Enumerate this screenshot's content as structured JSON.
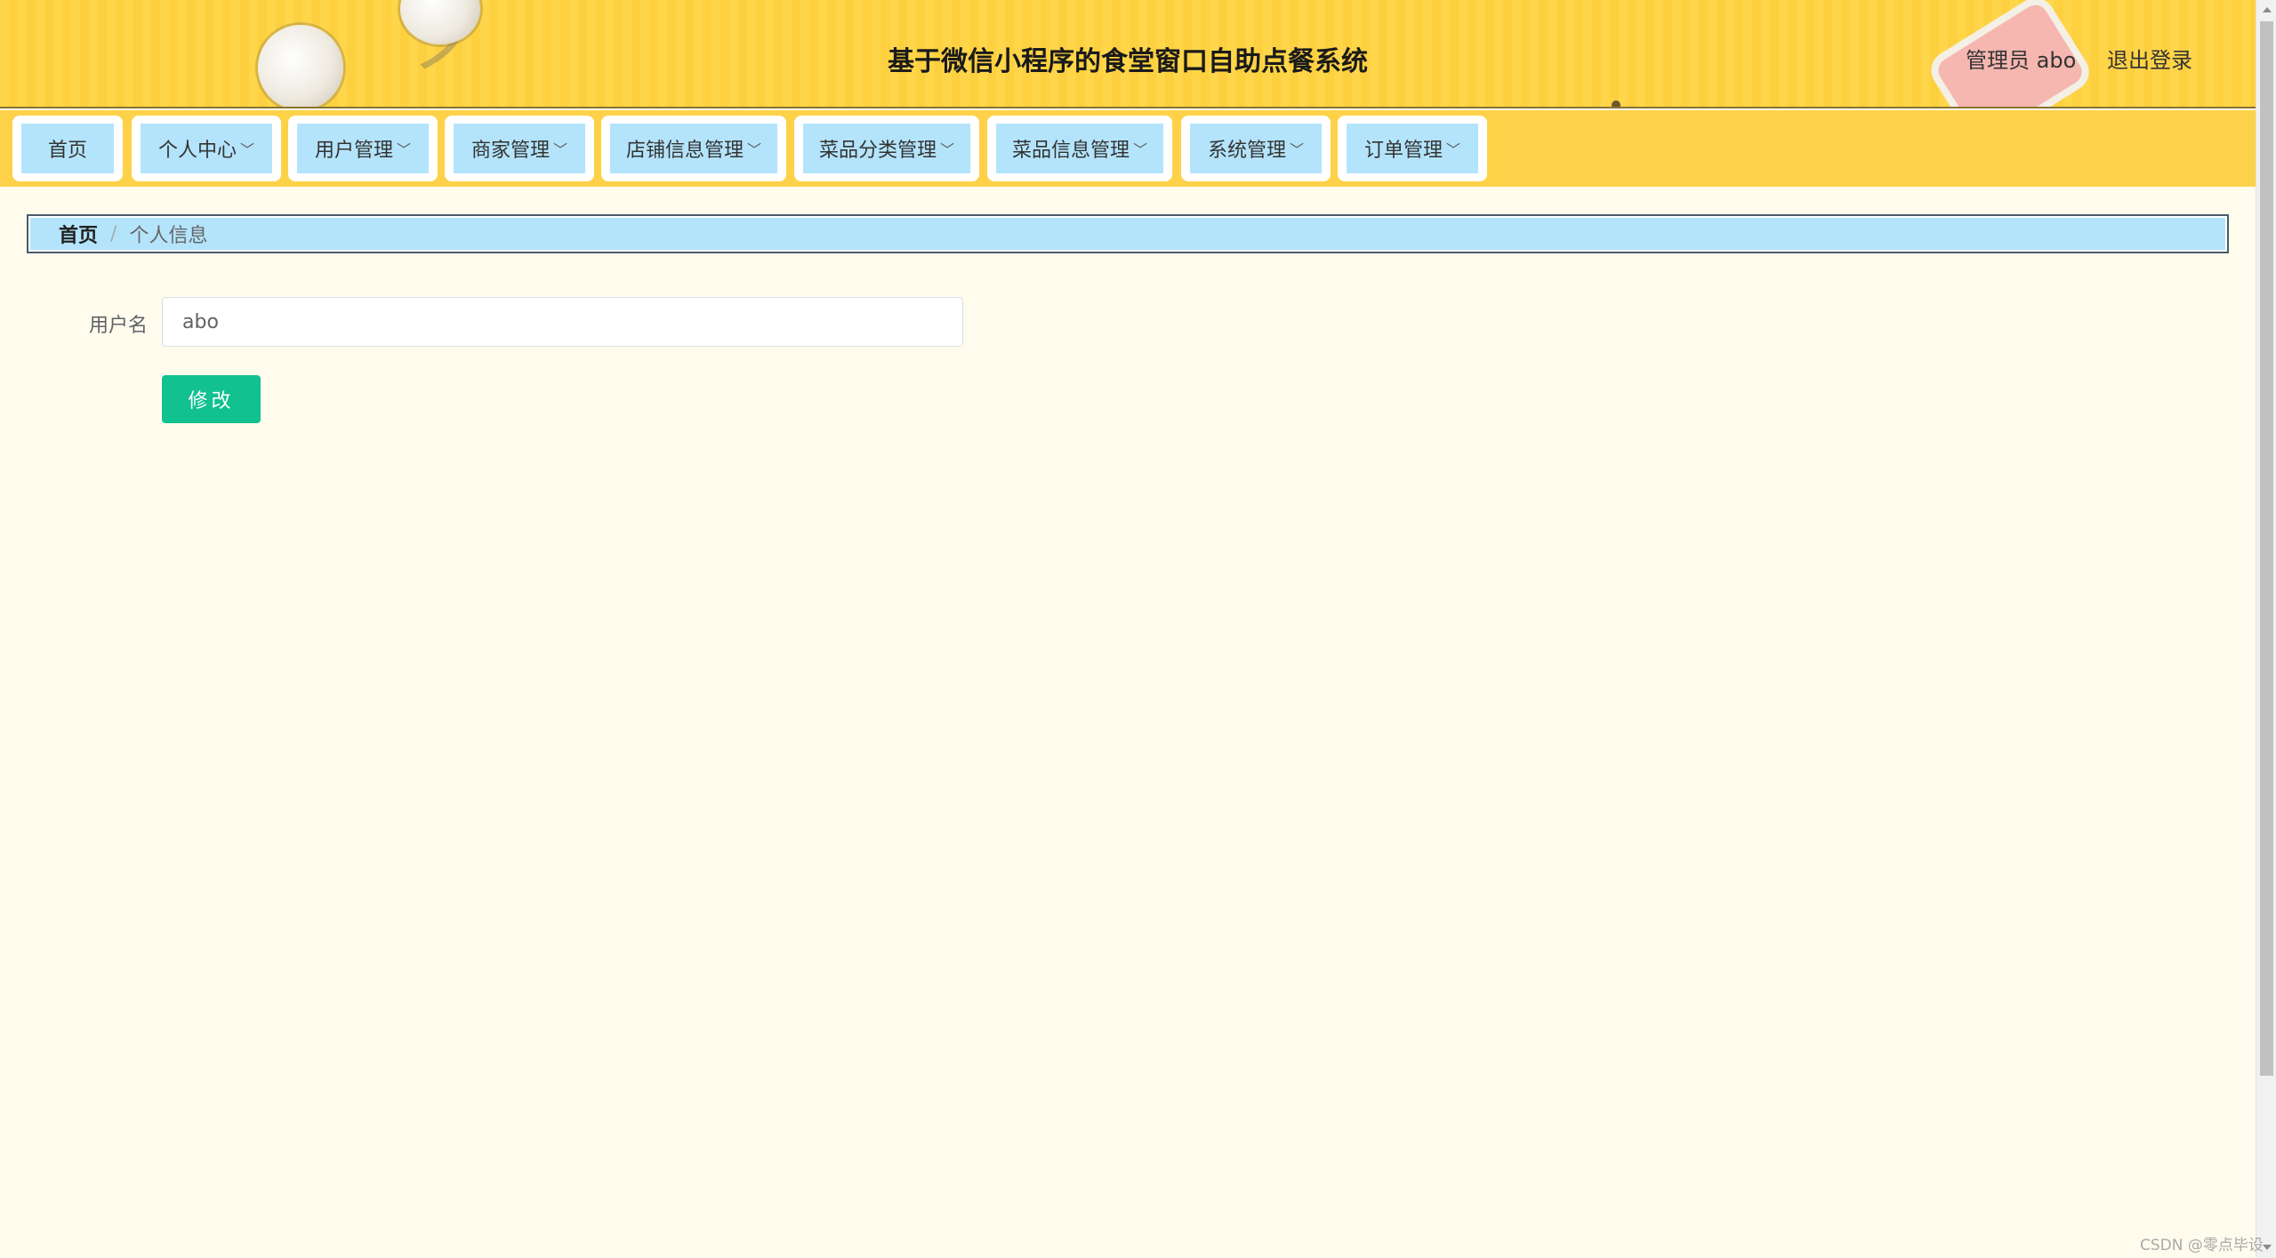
{
  "header": {
    "title": "基于微信小程序的食堂窗口自助点餐系统",
    "user_role": "管理员 abo",
    "logout_label": "退出登录"
  },
  "nav": {
    "items": [
      {
        "label": "首页",
        "has_dropdown": false
      },
      {
        "label": "个人中心",
        "has_dropdown": true
      },
      {
        "label": "用户管理",
        "has_dropdown": true
      },
      {
        "label": "商家管理",
        "has_dropdown": true
      },
      {
        "label": "店铺信息管理",
        "has_dropdown": true
      },
      {
        "label": "菜品分类管理",
        "has_dropdown": true
      },
      {
        "label": "菜品信息管理",
        "has_dropdown": true
      },
      {
        "label": "系统管理",
        "has_dropdown": true
      },
      {
        "label": "订单管理",
        "has_dropdown": true
      }
    ],
    "dropdown_icon": "chevron-down-icon"
  },
  "breadcrumb": {
    "home": "首页",
    "separator": "/",
    "current": "个人信息"
  },
  "form": {
    "username_label": "用户名",
    "username_value": "abo",
    "submit_label": "修改"
  },
  "watermark": "CSDN @零点毕设",
  "colors": {
    "header_bg": "#ffd64a",
    "nav_item_bg": "#b4e4fb",
    "page_bg": "#fffced",
    "submit_bg": "#11c18f"
  }
}
